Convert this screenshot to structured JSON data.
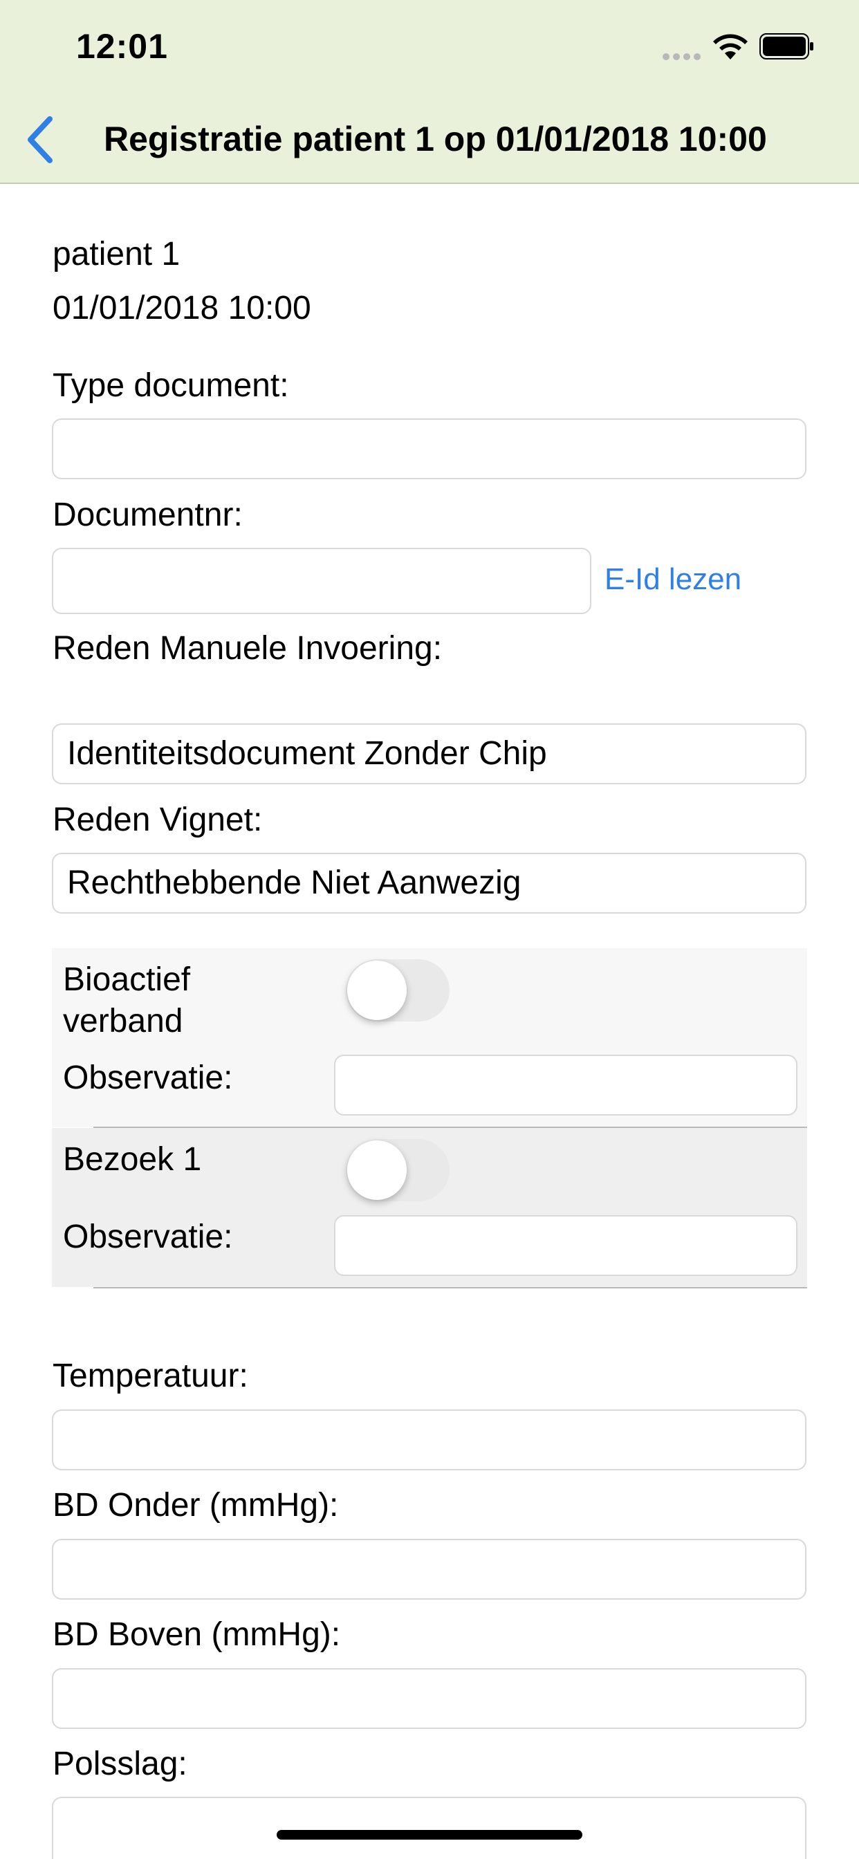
{
  "status_bar": {
    "time": "12:01"
  },
  "nav": {
    "title": "Registratie patient 1 op 01/01/2018 10:00"
  },
  "header": {
    "patient": "patient 1",
    "datetime": "01/01/2018  10:00"
  },
  "form": {
    "type_document": {
      "label": "Type document:",
      "value": ""
    },
    "documentnr": {
      "label": "Documentnr:",
      "value": "",
      "action": "E-Id lezen"
    },
    "reden_manuele": {
      "label": "Reden Manuele Invoering:",
      "value": "Identiteitsdocument Zonder Chip"
    },
    "reden_vignet": {
      "label": "Reden Vignet:",
      "value": "Rechthebbende Niet Aanwezig"
    },
    "items": [
      {
        "label": "Bioactief verband",
        "label_line1": "Bioactief",
        "label_line2": "verband",
        "toggle_on": false,
        "observatie_label": "Observatie:",
        "observatie_value": ""
      },
      {
        "label": "Bezoek 1",
        "toggle_on": false,
        "observatie_label": "Observatie:",
        "observatie_value": ""
      }
    ],
    "temperatuur": {
      "label": "Temperatuur:",
      "value": ""
    },
    "bd_onder": {
      "label": "BD Onder (mmHg):",
      "value": ""
    },
    "bd_boven": {
      "label": "BD Boven (mmHg):",
      "value": ""
    },
    "polsslag": {
      "label": "Polsslag:",
      "value": ""
    }
  },
  "colors": {
    "accent": "#2f7fe5",
    "bar_bg": "#e9f1da"
  },
  "icons": {
    "back": "chevron-left-icon",
    "wifi": "wifi-icon",
    "battery": "battery-icon",
    "signal": "signal-icon"
  }
}
